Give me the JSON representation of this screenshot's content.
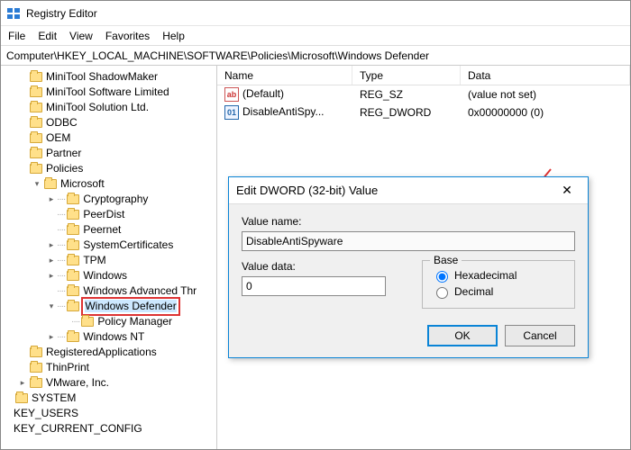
{
  "titlebar": {
    "title": "Registry Editor"
  },
  "menubar": {
    "items": [
      "File",
      "Edit",
      "View",
      "Favorites",
      "Help"
    ]
  },
  "address": "Computer\\HKEY_LOCAL_MACHINE\\SOFTWARE\\Policies\\Microsoft\\Windows Defender",
  "tree": {
    "items": [
      {
        "depth": 1,
        "label": "MiniTool ShadowMaker"
      },
      {
        "depth": 1,
        "label": "MiniTool Software Limited"
      },
      {
        "depth": 1,
        "label": "MiniTool Solution Ltd."
      },
      {
        "depth": 1,
        "label": "ODBC"
      },
      {
        "depth": 1,
        "label": "OEM"
      },
      {
        "depth": 1,
        "label": "Partner"
      },
      {
        "depth": 1,
        "label": "Policies",
        "expanded": true
      },
      {
        "depth": 2,
        "label": "Microsoft",
        "expanded": true,
        "twist": "v"
      },
      {
        "depth": 3,
        "label": "Cryptography",
        "twist": ">"
      },
      {
        "depth": 3,
        "label": "PeerDist"
      },
      {
        "depth": 3,
        "label": "Peernet"
      },
      {
        "depth": 3,
        "label": "SystemCertificates",
        "twist": ">"
      },
      {
        "depth": 3,
        "label": "TPM",
        "twist": ">"
      },
      {
        "depth": 3,
        "label": "Windows",
        "twist": ">"
      },
      {
        "depth": 3,
        "label": "Windows Advanced Thr"
      },
      {
        "depth": 3,
        "label": "Windows Defender",
        "twist": "v",
        "selected": true,
        "highlight": true
      },
      {
        "depth": 4,
        "label": "Policy Manager"
      },
      {
        "depth": 3,
        "label": "Windows NT",
        "twist": ">"
      },
      {
        "depth": 1,
        "label": "RegisteredApplications"
      },
      {
        "depth": 1,
        "label": "ThinPrint"
      },
      {
        "depth": 1,
        "label": "VMware, Inc.",
        "twist": ">"
      },
      {
        "depth": 0,
        "label": "SYSTEM"
      },
      {
        "depth": 0,
        "label": "KEY_USERS",
        "nofolder": true
      },
      {
        "depth": 0,
        "label": "KEY_CURRENT_CONFIG",
        "nofolder": true
      }
    ]
  },
  "list": {
    "headers": {
      "name": "Name",
      "type": "Type",
      "data": "Data"
    },
    "rows": [
      {
        "icon": "ab",
        "name": "(Default)",
        "type": "REG_SZ",
        "data": "(value not set)"
      },
      {
        "icon": "01",
        "name": "DisableAntiSpy...",
        "type": "REG_DWORD",
        "data": "0x00000000 (0)"
      }
    ]
  },
  "dialog": {
    "title": "Edit DWORD (32-bit) Value",
    "value_name_label": "Value name:",
    "value_name": "DisableAntiSpyware",
    "value_data_label": "Value data:",
    "value_data": "0",
    "base_label": "Base",
    "base_hex": "Hexadecimal",
    "base_dec": "Decimal",
    "ok": "OK",
    "cancel": "Cancel"
  }
}
